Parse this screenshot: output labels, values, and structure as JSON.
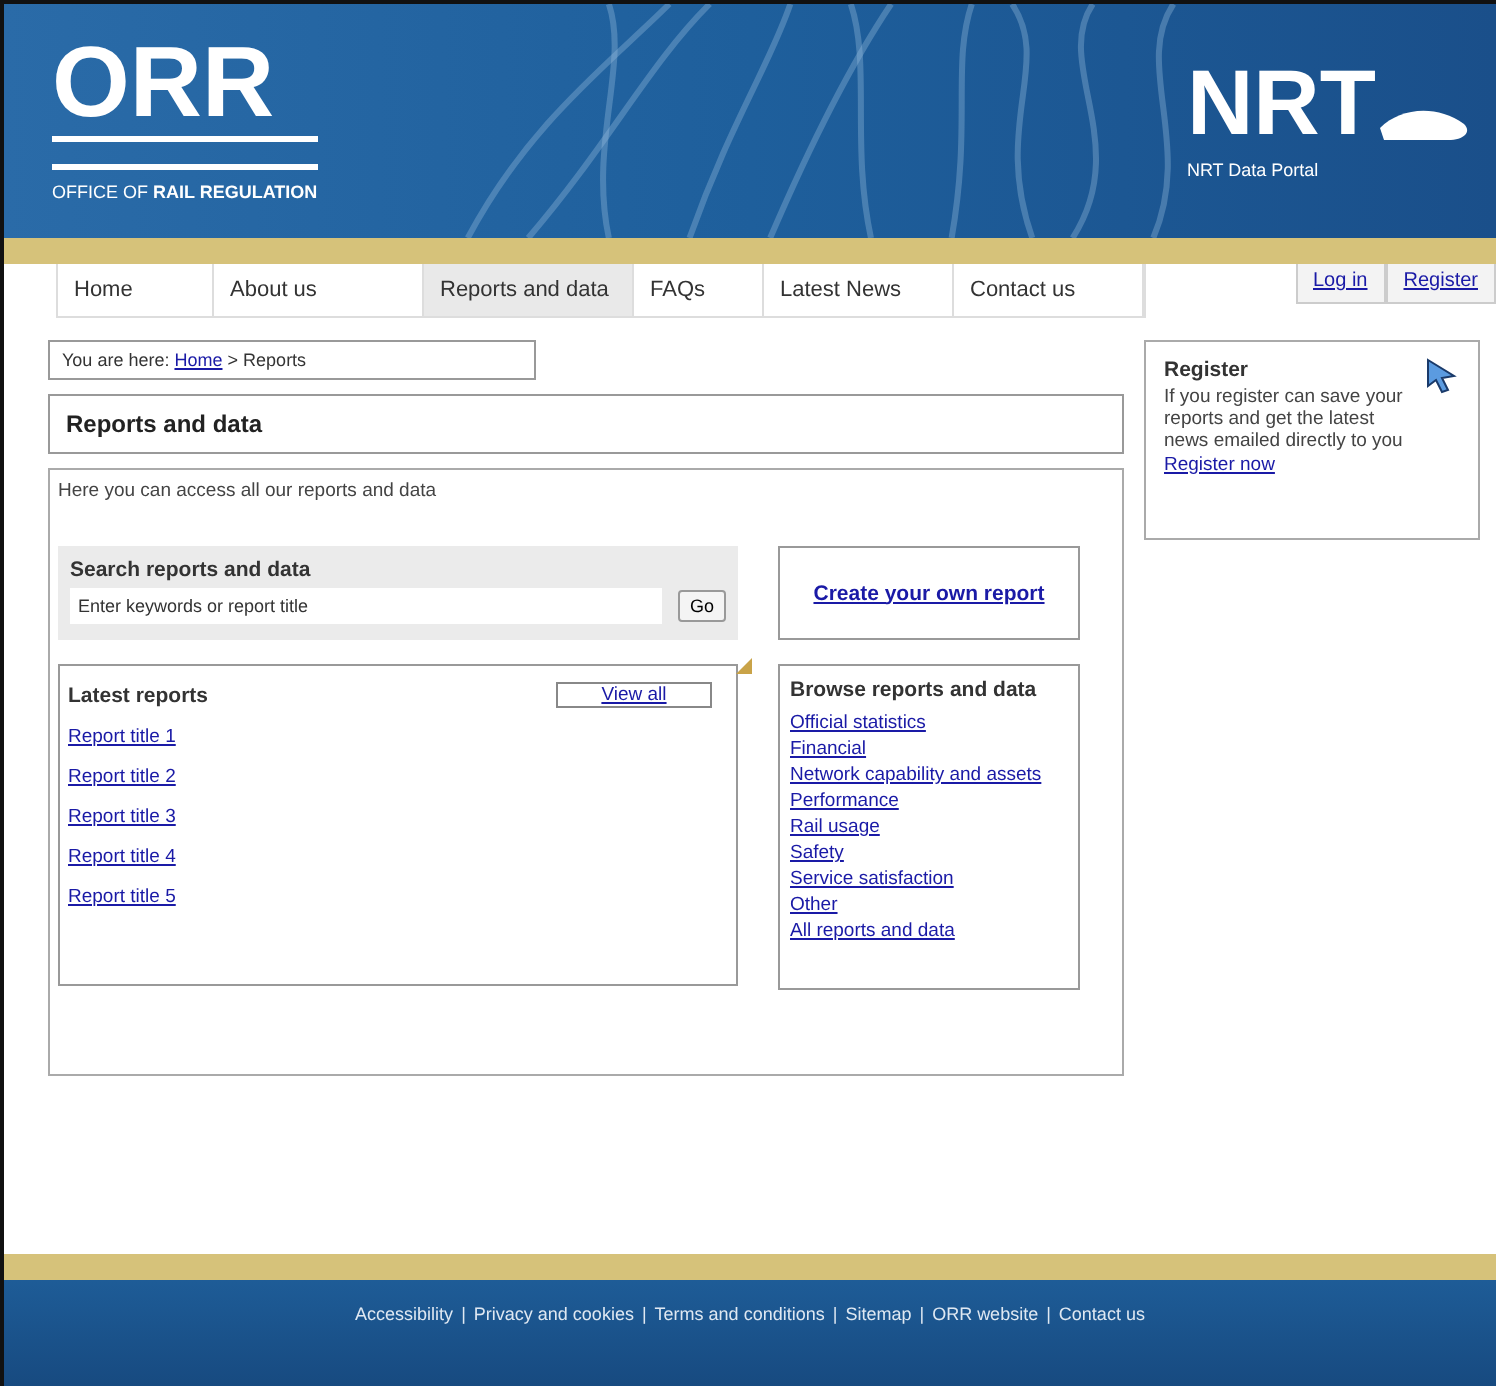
{
  "header": {
    "org_logo": "ORR",
    "org_name": "OFFICE OF **RAIL REGULATION**",
    "portal_logo": "NRT",
    "portal_name": "NRT Data Portal"
  },
  "nav": [
    {
      "label": "Home",
      "selected": false
    },
    {
      "label": "About us",
      "selected": false
    },
    {
      "label": "Reports and data",
      "selected": true
    },
    {
      "label": "FAQs",
      "selected": false
    },
    {
      "label": "Latest News",
      "selected": false
    },
    {
      "label": "Contact us",
      "selected": false
    }
  ],
  "account_links": [
    "Log in",
    "Register"
  ],
  "breadcrumb": {
    "prefix": "You are here:",
    "links": [
      "Home"
    ],
    "separator": ">",
    "current": "Reports"
  },
  "page_title": "Reports and data",
  "intro": "Here you can access all our reports and data",
  "search": {
    "title": "Search reports and data",
    "placeholder": "Enter keywords or report title",
    "button": "Go"
  },
  "latest": {
    "title": "Latest reports",
    "view_all": "View all",
    "items": [
      "Report title 1",
      "Report title 2",
      "Report title 3",
      "Report title 4",
      "Report title 5"
    ]
  },
  "create_link": "Create your own report",
  "browse": {
    "title": "Browse reports and data",
    "items": [
      "Official statistics",
      "Financial",
      "Network capability and assets",
      "Performance",
      "Rail usage",
      "Safety",
      "Service satisfaction",
      "Other",
      "All reports and data"
    ]
  },
  "register": {
    "title": "Register",
    "text": "If you register can save your reports and get the latest news emailed directly to you",
    "link": "Register now"
  },
  "footer": {
    "separator": "|",
    "links": [
      "Accessibility",
      "Privacy and cookies",
      "Terms and conditions",
      "Sitemap",
      "ORR website",
      "Contact us"
    ]
  }
}
